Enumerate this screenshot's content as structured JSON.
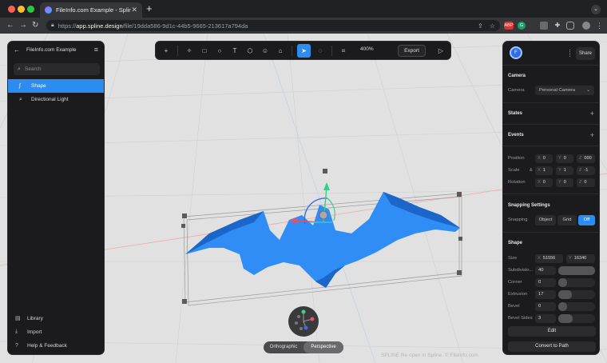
{
  "browser": {
    "tab_title": "FileInfo.com Example - Spline",
    "tab_close": "✕",
    "new_tab": "+",
    "tab_menu": "⌄",
    "url_scheme": "https://",
    "url_host": "app.spline.design",
    "url_path": "/file/19dda586-9d1c-44b5-9665-213617a794da",
    "ext_abp": "ABP",
    "ext_g": "G"
  },
  "left_panel": {
    "title": "FileInfo.com Example",
    "search_placeholder": "Search",
    "items": [
      {
        "label": "Shape",
        "icon": "shape-icon",
        "active": true
      },
      {
        "label": "Directional Light",
        "icon": "light-icon",
        "active": false
      }
    ],
    "bottom": [
      {
        "label": "Library",
        "icon": "library-icon"
      },
      {
        "label": "Import",
        "icon": "import-icon"
      },
      {
        "label": "Help & Feedback",
        "icon": "help-icon"
      }
    ]
  },
  "toolbar": {
    "zoom": "400%",
    "export_label": "Export"
  },
  "right_panel": {
    "avatar_initial": "F",
    "share_label": "Share",
    "camera": {
      "section": "Camera",
      "label": "Camera",
      "value": "Personal Camera"
    },
    "states": "States",
    "events": "Events",
    "position": {
      "label": "Position",
      "x": "0",
      "y": "0",
      "z": "000"
    },
    "scale": {
      "label": "Scale",
      "x": "1",
      "y": "1",
      "z": "-1"
    },
    "rotation": {
      "label": "Rotation",
      "x": "0",
      "y": "0",
      "z": "0"
    },
    "snapping": {
      "section": "Snapping Settings",
      "label": "Snapping",
      "options": [
        "Object",
        "Grid",
        "Off"
      ],
      "selected": "Off"
    },
    "shape": {
      "section": "Shape",
      "size_label": "Size",
      "size_x": "51556",
      "size_y": "16340",
      "subdivisions_label": "Subdivisio...",
      "subdivisions_value": "40",
      "subdivisions_level": 1.0,
      "corner_label": "Corner",
      "corner_value": "0",
      "corner_level": 0.0,
      "extrusion_label": "Extrusion",
      "extrusion_value": "17",
      "extrusion_level": 0.17,
      "bevel_label": "Bevel",
      "bevel_value": "0",
      "bevel_level": 0.0,
      "bevel_sides_label": "Bevel Sides",
      "bevel_sides_value": "3",
      "bevel_sides_level": 0.2
    },
    "edit_label": "Edit",
    "convert_label": "Convert to Path"
  },
  "view_toggle": {
    "options": [
      "Orthographic",
      "Perspective"
    ],
    "selected": "Perspective"
  },
  "watermark": "SPLINE file open in Spline. © FileInfo.com",
  "colors": {
    "accent": "#2d8cf0",
    "shape": "#2f8df5",
    "shape_dark": "#1c66c9"
  }
}
